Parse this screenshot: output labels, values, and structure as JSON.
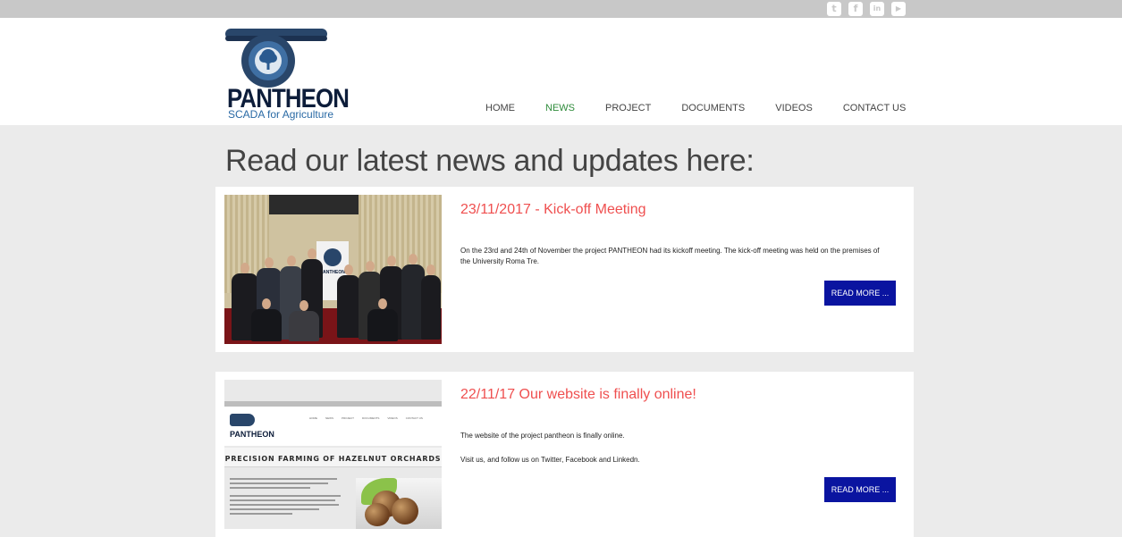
{
  "topbar": {
    "social_icons": [
      {
        "name": "twitter-icon",
        "glyph": "t"
      },
      {
        "name": "facebook-icon",
        "glyph": "f"
      },
      {
        "name": "linkedin-icon",
        "glyph": "in"
      },
      {
        "name": "youtube-icon",
        "glyph": "▶"
      }
    ]
  },
  "logo": {
    "word": "PANTHEON",
    "tagline": "SCADA for Agriculture"
  },
  "nav": {
    "items": [
      {
        "label": "HOME",
        "active": false
      },
      {
        "label": "NEWS",
        "active": true
      },
      {
        "label": "PROJECT",
        "active": false
      },
      {
        "label": "DOCUMENTS",
        "active": false
      },
      {
        "label": "VIDEOS",
        "active": false
      },
      {
        "label": "CONTACT US",
        "active": false
      }
    ]
  },
  "page": {
    "heading": "Read our latest news and updates here:"
  },
  "news": [
    {
      "title": "23/11/2017 - Kick-off Meeting",
      "paragraphs": [
        "On the 23rd and 24th of November the project PANTHEON had its kickoff meeting. The kick-off meeting was held on the premises of the University Roma Tre."
      ],
      "button": "READ MORE ...",
      "banner_text": "PANTHEON"
    },
    {
      "title": "22/11/17 Our website is finally online!",
      "paragraphs": [
        "The website of the project pantheon is finally online.",
        "Visit us, and follow us on Twitter, Facebook and Linkedn."
      ],
      "button": "READ MORE ...",
      "thumbnail": {
        "word": "PANTHEON",
        "band_text": "PRECISION FARMING OF HAZELNUT ORCHARDS",
        "nav": [
          "HOME",
          "NEWS",
          "PROJECT",
          "DOCUMENTS",
          "VIDEOS",
          "CONTACT US"
        ]
      }
    }
  ],
  "colors": {
    "accent_title": "#ef4f4f",
    "nav_active": "#2e8b3a",
    "button": "#0a14a0",
    "logo_dark": "#0d1d3a",
    "logo_blue": "#2a6aa5"
  }
}
